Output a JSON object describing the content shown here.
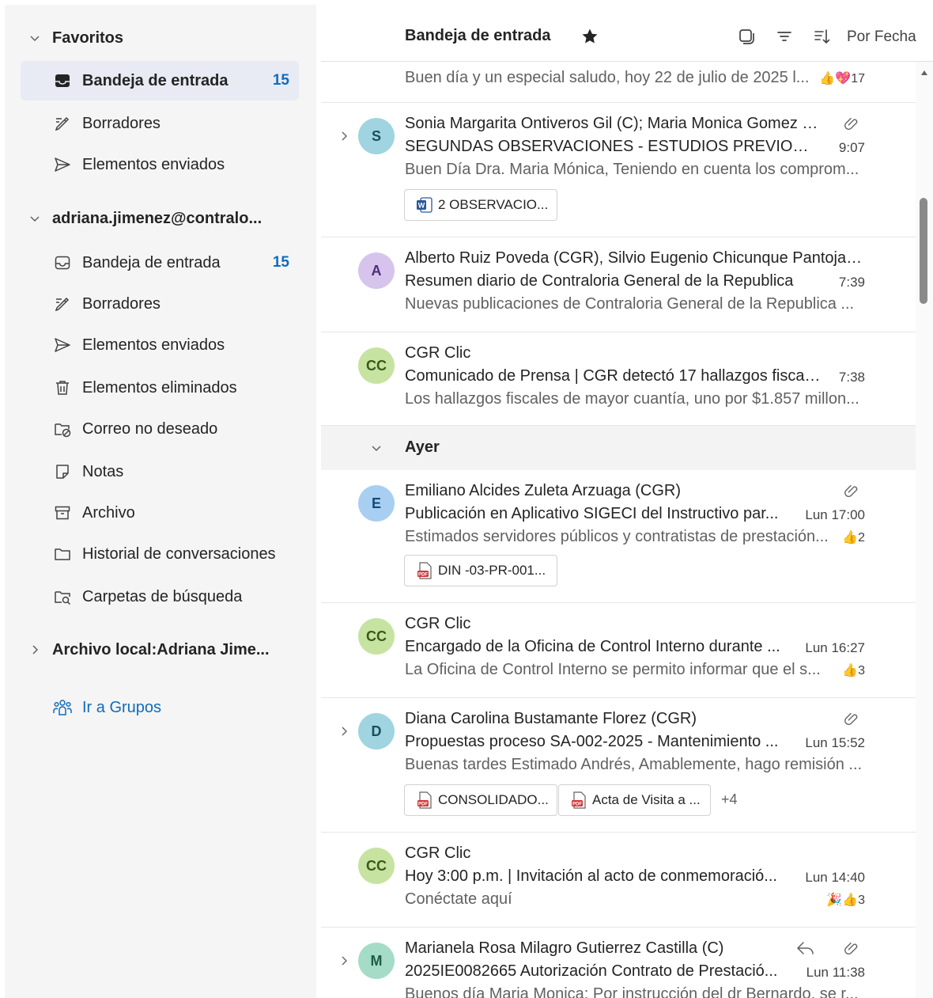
{
  "colors": {
    "accent": "#0f6cbd",
    "sidebar_bg": "#f5f5f5",
    "selected_bg": "#e8ebf4"
  },
  "sidebar": {
    "favoritos": {
      "title": "Favoritos",
      "items": [
        {
          "label": "Bandeja de entrada",
          "count": "15",
          "icon": "inbox-filled-icon"
        },
        {
          "label": "Borradores",
          "icon": "drafts-icon"
        },
        {
          "label": "Elementos enviados",
          "icon": "send-icon"
        }
      ]
    },
    "account": {
      "title": "adriana.jimenez@contralo...",
      "items": [
        {
          "label": "Bandeja de entrada",
          "count": "15",
          "icon": "inbox-icon"
        },
        {
          "label": "Borradores",
          "icon": "drafts-icon"
        },
        {
          "label": "Elementos enviados",
          "icon": "send-icon"
        },
        {
          "label": "Elementos eliminados",
          "icon": "trash-icon"
        },
        {
          "label": "Correo no deseado",
          "icon": "junk-icon"
        },
        {
          "label": "Notas",
          "icon": "note-icon"
        },
        {
          "label": "Archivo",
          "icon": "archive-icon"
        },
        {
          "label": "Historial de conversaciones",
          "icon": "folder-icon"
        },
        {
          "label": "Carpetas de búsqueda",
          "icon": "search-folder-icon"
        }
      ]
    },
    "local": {
      "title": "Archivo local:Adriana Jime..."
    },
    "grupos": {
      "label": "Ir a Grupos",
      "icon": "groups-icon"
    }
  },
  "list": {
    "title": "Bandeja de entrada",
    "sort_label": "Por Fecha",
    "group_ayer": "Ayer",
    "messages": [
      {
        "preview": "Buen día y un especial saludo, hoy 22 de julio de 2025 l...",
        "reactions": "17"
      },
      {
        "initial": "S",
        "from": "Sonia Margarita Ontiveros Gil (C); Maria Monica Gomez L...",
        "subject": "SEGUNDAS OBSERVACIONES - ESTUDIOS PREVIOS - M...",
        "time": "9:07",
        "preview": "Buen Día Dra. Maria Mónica, Teniendo en cuenta los comprom...",
        "attachments": [
          "2 OBSERVACIO..."
        ]
      },
      {
        "initial": "A",
        "from": "Alberto Ruiz Poveda (CGR), Silvio Eugenio Chicunque Pantoja (...",
        "subject": "Resumen diario de Contraloria General de la Republica",
        "time": "7:39",
        "preview": "Nuevas publicaciones de Contraloria General de la Republica  ..."
      },
      {
        "initial": "CC",
        "from": "CGR Clic",
        "subject": "Comunicado de Prensa | CGR detectó 17 hallazgos fiscal...",
        "time": "7:38",
        "preview": "Los hallazgos fiscales de mayor cuantía, uno por $1.857 millon..."
      },
      {
        "initial": "E",
        "from": "Emiliano Alcides Zuleta Arzuaga (CGR)",
        "subject": "Publicación en Aplicativo SIGECI del Instructivo par...",
        "time": "Lun 17:00",
        "preview": "Estimados servidores públicos y contratistas de prestación...",
        "reactions": "2",
        "attachments": [
          "DIN -03-PR-001..."
        ]
      },
      {
        "initial": "CC",
        "from": "CGR Clic",
        "subject": "Encargado de la Oficina de Control Interno durante ...",
        "time": "Lun 16:27",
        "preview": "La Oficina de Control Interno se permito informar que el s...",
        "reactions": "3"
      },
      {
        "initial": "D",
        "from": "Diana Carolina Bustamante Florez (CGR)",
        "subject": "Propuestas proceso SA-002-2025 - Mantenimiento ...",
        "time": "Lun 15:52",
        "preview": "Buenas tardes Estimado Andrés, Amablemente, hago remisión ...",
        "attachments": [
          "CONSOLIDADO...",
          "Acta de Visita a ..."
        ],
        "more": "+4"
      },
      {
        "initial": "CC",
        "from": "CGR Clic",
        "subject": "Hoy 3:00 p.m. | Invitación al acto de conmemoració...",
        "time": "Lun 14:40",
        "preview": "Conéctate aquí",
        "reactions": "3"
      },
      {
        "initial": "M",
        "from": "Marianela Rosa Milagro Gutierrez Castilla (C)",
        "subject": "2025IE0082665 Autorización Contrato de Prestació...",
        "time": "Lun 11:38",
        "preview": "Buenos día Maria Monica: Por instrucción del dr Bernardo, se r..."
      }
    ]
  }
}
